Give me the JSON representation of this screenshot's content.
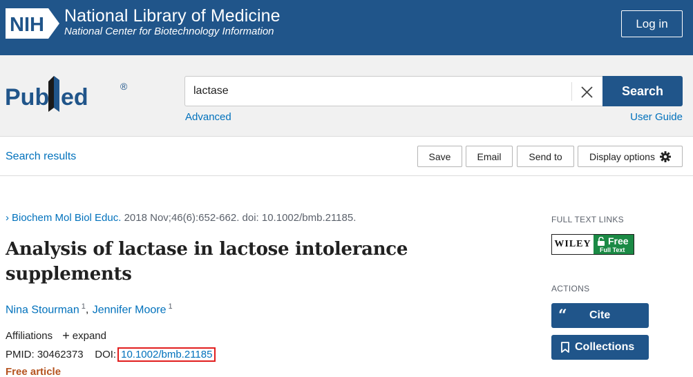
{
  "banner": {
    "logo_text": "NIH",
    "title": "National Library of Medicine",
    "subtitle": "National Center for Biotechnology Information",
    "login_label": "Log in",
    "bg_color": "#20558a"
  },
  "search": {
    "logo_text": "PubMed",
    "query": "lactase",
    "button_label": "Search",
    "advanced_label": "Advanced",
    "user_guide_label": "User Guide"
  },
  "toolbar": {
    "back_label": "Search results",
    "save_label": "Save",
    "email_label": "Email",
    "send_label": "Send to",
    "display_label": "Display options"
  },
  "article": {
    "journal": "Biochem Mol Biol Educ.",
    "citation_rest": "2018 Nov;46(6):652-662. doi: 10.1002/bmb.21185.",
    "title": "Analysis of lactase in lactose intolerance supplements",
    "authors": [
      {
        "name": "Nina Stourman",
        "sup": "1"
      },
      {
        "name": "Jennifer Moore",
        "sup": "1"
      }
    ],
    "affiliations_label": "Affiliations",
    "expand_label": "expand",
    "pmid_label": "PMID:",
    "pmid": "30462373",
    "doi_label": "DOI:",
    "doi": "10.1002/bmb.21185",
    "free_label": "Free article"
  },
  "sidebar": {
    "full_text_label": "FULL TEXT LINKS",
    "wiley_brand": "WILEY",
    "wiley_free": "Free",
    "wiley_fulltext": "Full Text",
    "actions_label": "ACTIONS",
    "cite_label": "Cite",
    "collections_label": "Collections"
  }
}
